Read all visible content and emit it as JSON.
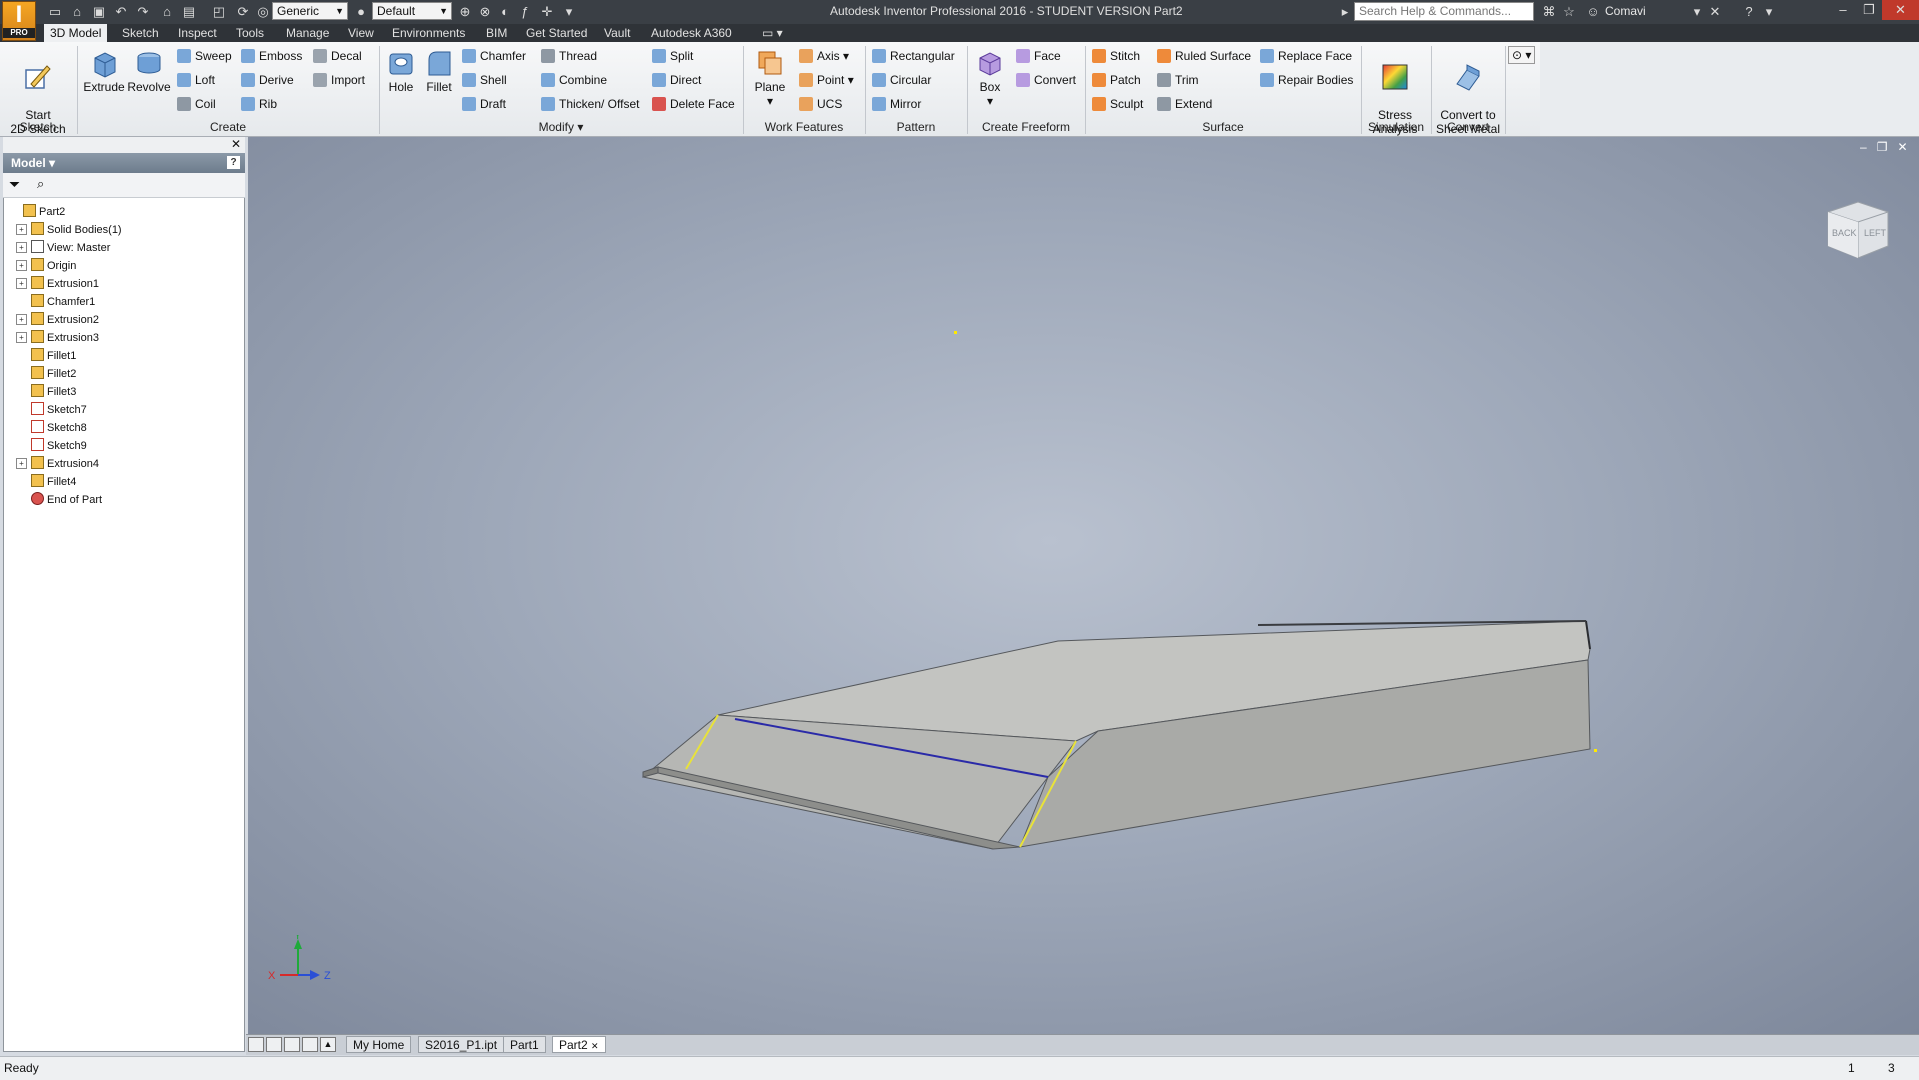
{
  "app": {
    "logo_letter": "I",
    "logo_sub": "PRO",
    "title": "Autodesk Inventor Professional 2016 - STUDENT VERSION    Part2",
    "material": "Generic",
    "appearance": "Default",
    "search_placeholder": "Search Help & Commands...",
    "user": "Comavi"
  },
  "ribbon_tabs": [
    "3D Model",
    "Sketch",
    "Inspect",
    "Tools",
    "Manage",
    "View",
    "Environments",
    "BIM",
    "Get Started",
    "Vault",
    "Autodesk A360"
  ],
  "ribbon": {
    "sketch": {
      "title": "Sketch",
      "start_label": "Start\n2D Sketch"
    },
    "create": {
      "title": "Create",
      "extrude": "Extrude",
      "revolve": "Revolve",
      "sweep": "Sweep",
      "loft": "Loft",
      "coil": "Coil",
      "emboss": "Emboss",
      "derive": "Derive",
      "rib": "Rib",
      "decal": "Decal",
      "import": "Import"
    },
    "modify": {
      "title": "Modify",
      "hole": "Hole",
      "fillet": "Fillet",
      "chamfer": "Chamfer",
      "shell": "Shell",
      "draft": "Draft",
      "thread": "Thread",
      "combine": "Combine",
      "thicken": "Thicken/ Offset",
      "split": "Split",
      "direct": "Direct",
      "delete_face": "Delete Face"
    },
    "work_features": {
      "title": "Work Features",
      "plane": "Plane",
      "axis": "Axis",
      "point": "Point",
      "ucs": "UCS"
    },
    "pattern": {
      "title": "Pattern",
      "rectangular": "Rectangular",
      "circular": "Circular",
      "mirror": "Mirror"
    },
    "create_freeform": {
      "title": "Create Freeform",
      "box": "Box",
      "face": "Face",
      "convert": "Convert"
    },
    "surface": {
      "title": "Surface",
      "stitch": "Stitch",
      "patch": "Patch",
      "sculpt": "Sculpt",
      "ruled_surface": "Ruled Surface",
      "trim": "Trim",
      "extend": "Extend",
      "replace_face": "Replace Face",
      "repair_bodies": "Repair Bodies"
    },
    "simulation": {
      "title": "Simulation",
      "stress_analysis": "Stress\nAnalysis"
    },
    "convert": {
      "title": "Convert",
      "sheet_metal": "Convert to\nSheet Metal"
    }
  },
  "browser": {
    "title": "Model",
    "tree": [
      {
        "label": "Part2",
        "kind": "part",
        "expand": false,
        "indent": 0
      },
      {
        "label": "Solid Bodies(1)",
        "kind": "folder",
        "expand": true,
        "indent": 1
      },
      {
        "label": "View: Master",
        "kind": "view",
        "expand": true,
        "indent": 1
      },
      {
        "label": "Origin",
        "kind": "folder",
        "expand": true,
        "indent": 1
      },
      {
        "label": "Extrusion1",
        "kind": "feature",
        "expand": true,
        "indent": 1
      },
      {
        "label": "Chamfer1",
        "kind": "feature",
        "expand": false,
        "indent": 1
      },
      {
        "label": "Extrusion2",
        "kind": "feature",
        "expand": true,
        "indent": 1
      },
      {
        "label": "Extrusion3",
        "kind": "feature",
        "expand": true,
        "indent": 1
      },
      {
        "label": "Fillet1",
        "kind": "feature",
        "expand": false,
        "indent": 1
      },
      {
        "label": "Fillet2",
        "kind": "feature",
        "expand": false,
        "indent": 1
      },
      {
        "label": "Fillet3",
        "kind": "feature",
        "expand": false,
        "indent": 1
      },
      {
        "label": "Sketch7",
        "kind": "sketch",
        "expand": false,
        "indent": 1
      },
      {
        "label": "Sketch8",
        "kind": "sketch",
        "expand": false,
        "indent": 1
      },
      {
        "label": "Sketch9",
        "kind": "sketch",
        "expand": false,
        "indent": 1
      },
      {
        "label": "Extrusion4",
        "kind": "feature",
        "expand": true,
        "indent": 1
      },
      {
        "label": "Fillet4",
        "kind": "feature",
        "expand": false,
        "indent": 1
      },
      {
        "label": "End of Part",
        "kind": "end",
        "expand": false,
        "indent": 1
      }
    ]
  },
  "viewcube": {
    "back": "BACK",
    "left": "LEFT"
  },
  "triad": {
    "x": "X",
    "y": "Y",
    "z": "Z"
  },
  "doc_tabs": [
    "My Home",
    "S2016_P1.ipt",
    "Part1",
    "Part2"
  ],
  "active_doc": "Part2",
  "status": {
    "text": "Ready",
    "count_a": "1",
    "count_b": "3"
  }
}
